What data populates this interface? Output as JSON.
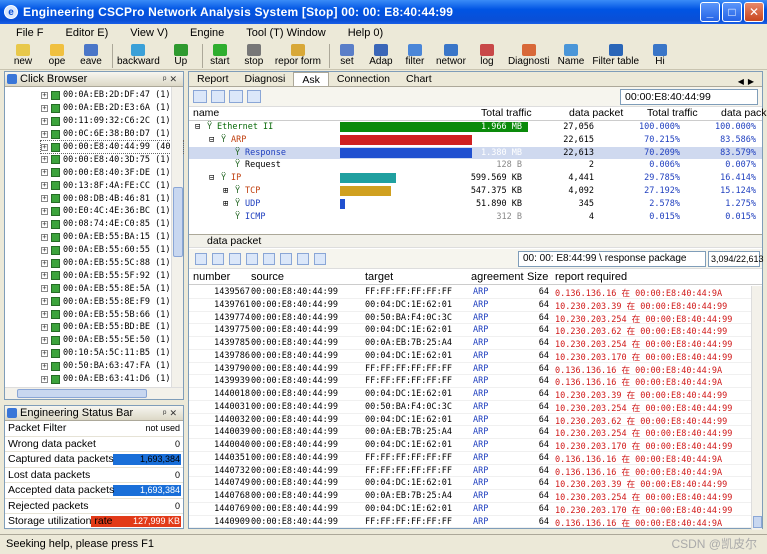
{
  "window": {
    "title": "Engineering CSCPro Network Analysis System [Stop] 00: 00: E8:40:44:99",
    "controls": [
      "_",
      "□",
      "✕"
    ]
  },
  "menu": [
    "File F",
    "Editor E)",
    "View V)",
    "Engine",
    "Tool (T) Window",
    "Help 0)"
  ],
  "toolbar": [
    {
      "label": "new",
      "color": "#e8c84a"
    },
    {
      "label": "ope",
      "color": "#f0c040"
    },
    {
      "label": "eave",
      "color": "#4a76c8"
    },
    {
      "label": "backward",
      "color": "#3aa0d8"
    },
    {
      "label": "Up",
      "color": "#2f9a2f"
    },
    {
      "label": "start",
      "color": "#2fae2f"
    },
    {
      "label": "stop",
      "color": "#777777"
    },
    {
      "label": "repor form",
      "color": "#d8a838"
    },
    {
      "label": "set",
      "color": "#5a7ec8"
    },
    {
      "label": "Adap",
      "color": "#3a66b8"
    },
    {
      "label": "filter",
      "color": "#4a86d8"
    },
    {
      "label": "networ",
      "color": "#3a76c8"
    },
    {
      "label": "log",
      "color": "#c84848"
    },
    {
      "label": "Diagnosti",
      "color": "#d86838"
    },
    {
      "label": "Name",
      "color": "#4a96d8"
    },
    {
      "label": "Filter table",
      "color": "#2a66b8"
    },
    {
      "label": "Hi",
      "color": "#3a76c8"
    }
  ],
  "browser": {
    "title": "Click Browser",
    "items": [
      "00:0A:EB:2D:DF:47 (1)",
      "00:0A:EB:2D:E3:6A (1)",
      "00:11:09:32:C6:2C (1)",
      "00:0C:6E:38:B0:D7 (1)",
      "00:00:E8:40:44:99 (40)",
      "00:00:E8:40:3D:75 (1)",
      "00:00:E8:40:3F:DE (1)",
      "00:13:8F:4A:FE:CC (1)",
      "00:08:DB:4B:46:81 (1)",
      "00:E0:4C:4E:36:BC (1)",
      "00:08:74:4E:C0:85 (1)",
      "00:0A:EB:55:BA:15 (1)",
      "00:0A:EB:55:60:55 (1)",
      "00:0A:EB:55:5C:88 (1)",
      "00:0A:EB:55:5F:92 (1)",
      "00:0A:EB:55:8E:5A (1)",
      "00:0A:EB:55:8E:F9 (1)",
      "00:0A:EB:55:5B:66 (1)",
      "00:0A:EB:55:BD:BE (1)",
      "00:0A:EB:55:5E:50 (1)",
      "00:10:5A:5C:11:B5 (1)",
      "00:50:BA:63:47:FA (1)",
      "00:0A:EB:63:41:D6 (1)"
    ],
    "selected_index": 4
  },
  "status": {
    "title": "Engineering Status Bar",
    "rows": [
      {
        "label": "Packet Filter",
        "value": "not used"
      },
      {
        "label": "Wrong data packet",
        "value": "0"
      },
      {
        "label": "Captured data packets",
        "value": "1,693,384"
      },
      {
        "label": "Lost data packets",
        "value": "0"
      },
      {
        "label": "Accepted data packets",
        "value": "1,693,384"
      },
      {
        "label": "Rejected packets",
        "value": "0"
      },
      {
        "label": "Storage utilization rate",
        "value": "127,999 KB"
      }
    ]
  },
  "tabs": [
    "Report",
    "Diagnosi",
    "Ask",
    "Connection",
    "Chart"
  ],
  "active_tab": 2,
  "timestamp": "00:00:E8:40:44:99",
  "protocol": {
    "headers": [
      "name",
      "Total traffic",
      "data packet",
      "Total traffic",
      "data packet"
    ],
    "rows": [
      {
        "name": "Ethernet II",
        "indent": 0,
        "traffic": "1.966 MB",
        "packets": "27,056",
        "pct_traffic": "100.000%",
        "pct_packets": "100.000%",
        "bar": 1.0,
        "bar_color": "#0a8a0a"
      },
      {
        "name": "ARP",
        "indent": 1,
        "traffic": "1.380 MB",
        "packets": "22,615",
        "pct_traffic": "70.215%",
        "pct_packets": "83.586%",
        "bar": 0.7,
        "bar_color": "#d02020"
      },
      {
        "name": "Response",
        "indent": 2,
        "traffic": "1.380 MB",
        "packets": "22,613",
        "pct_traffic": "70.209%",
        "pct_packets": "83.579%",
        "bar": 0.7,
        "bar_color": "#2050d0"
      },
      {
        "name": "Request",
        "indent": 2,
        "traffic": "128 B",
        "packets": "2",
        "pct_traffic": "0.006%",
        "pct_packets": "0.007%",
        "bar": 0.0,
        "bar_color": "#2050d0"
      },
      {
        "name": "IP",
        "indent": 1,
        "traffic": "599.569 KB",
        "packets": "4,441",
        "pct_traffic": "29.785%",
        "pct_packets": "16.414%",
        "bar": 0.3,
        "bar_color": "#20a0a0"
      },
      {
        "name": "TCP",
        "indent": 2,
        "traffic": "547.375 KB",
        "packets": "4,092",
        "pct_traffic": "27.192%",
        "pct_packets": "15.124%",
        "bar": 0.27,
        "bar_color": "#d0a020"
      },
      {
        "name": "UDP",
        "indent": 2,
        "traffic": "51.890 KB",
        "packets": "345",
        "pct_traffic": "2.578%",
        "pct_packets": "1.275%",
        "bar": 0.026,
        "bar_color": "#2050d0"
      },
      {
        "name": "ICMP",
        "indent": 2,
        "traffic": "312 B",
        "packets": "4",
        "pct_traffic": "0.015%",
        "pct_packets": "0.015%",
        "bar": 0.0,
        "bar_color": "#2050d0"
      }
    ]
  },
  "packets": {
    "section_title": "data packet",
    "info": "00: 00: E8:44:99 \\ response package",
    "count": "3,094/22,613",
    "headers": [
      "number",
      "source",
      "target",
      "agreement",
      "Size",
      "report required"
    ],
    "rows": [
      [
        "1439567",
        "00:00:E8:40:44:99",
        "FF:FF:FF:FF:FF:FF",
        "ARP",
        "64",
        "0.136.136.16 在 00:00:E8:40:44:9A"
      ],
      [
        "1439761",
        "00:00:E8:40:44:99",
        "00:04:DC:1E:62:01",
        "ARP",
        "64",
        "10.230.203.39 在 00:00:E8:40:44:99"
      ],
      [
        "1439774",
        "00:00:E8:40:44:99",
        "00:50:BA:F4:0C:3C",
        "ARP",
        "64",
        "10.230.203.254 在 00:00:E8:40:44:99"
      ],
      [
        "1439775",
        "00:00:E8:40:44:99",
        "00:04:DC:1E:62:01",
        "ARP",
        "64",
        "10.230.203.62 在 00:00:E8:40:44:99"
      ],
      [
        "1439785",
        "00:00:E8:40:44:99",
        "00:0A:EB:7B:25:A4",
        "ARP",
        "64",
        "10.230.203.254 在 00:00:E8:40:44:99"
      ],
      [
        "1439786",
        "00:00:E8:40:44:99",
        "00:04:DC:1E:62:01",
        "ARP",
        "64",
        "10.230.203.170 在 00:00:E8:40:44:99"
      ],
      [
        "1439790",
        "00:00:E8:40:44:99",
        "FF:FF:FF:FF:FF:FF",
        "ARP",
        "64",
        "0.136.136.16 在 00:00:E8:40:44:9A"
      ],
      [
        "1439939",
        "00:00:E8:40:44:99",
        "FF:FF:FF:FF:FF:FF",
        "ARP",
        "64",
        "0.136.136.16 在 00:00:E8:40:44:9A"
      ],
      [
        "1440018",
        "00:00:E8:40:44:99",
        "00:04:DC:1E:62:01",
        "ARP",
        "64",
        "10.230.203.39 在 00:00:E8:40:44:99"
      ],
      [
        "1440031",
        "00:00:E8:40:44:99",
        "00:50:BA:F4:0C:3C",
        "ARP",
        "64",
        "10.230.203.254 在 00:00:E8:40:44:99"
      ],
      [
        "1440032",
        "00:00:E8:40:44:99",
        "00:04:DC:1E:62:01",
        "ARP",
        "64",
        "10.230.203.62 在 00:00:E8:40:44:99"
      ],
      [
        "1440039",
        "00:00:E8:40:44:99",
        "00:0A:EB:7B:25:A4",
        "ARP",
        "64",
        "10.230.203.254 在 00:00:E8:40:44:99"
      ],
      [
        "1440040",
        "00:00:E8:40:44:99",
        "00:04:DC:1E:62:01",
        "ARP",
        "64",
        "10.230.203.170 在 00:00:E8:40:44:99"
      ],
      [
        "1440351",
        "00:00:E8:40:44:99",
        "FF:FF:FF:FF:FF:FF",
        "ARP",
        "64",
        "0.136.136.16 在 00:00:E8:40:44:9A"
      ],
      [
        "1440732",
        "00:00:E8:40:44:99",
        "FF:FF:FF:FF:FF:FF",
        "ARP",
        "64",
        "0.136.136.16 在 00:00:E8:40:44:9A"
      ],
      [
        "1440749",
        "00:00:E8:40:44:99",
        "00:04:DC:1E:62:01",
        "ARP",
        "64",
        "10.230.203.39 在 00:00:E8:40:44:99"
      ],
      [
        "1440768",
        "00:00:E8:40:44:99",
        "00:0A:EB:7B:25:A4",
        "ARP",
        "64",
        "10.230.203.254 在 00:00:E8:40:44:99"
      ],
      [
        "1440769",
        "00:00:E8:40:44:99",
        "00:04:DC:1E:62:01",
        "ARP",
        "64",
        "10.230.203.170 在 00:00:E8:40:44:99"
      ],
      [
        "1440909",
        "00:00:E8:40:44:99",
        "FF:FF:FF:FF:FF:FF",
        "ARP",
        "64",
        "0.136.136.16 在 00:00:E8:40:44:9A"
      ]
    ]
  },
  "statusbar": {
    "text": "Seeking help, please press F1",
    "watermark": "CSDN @凯皮尔"
  }
}
